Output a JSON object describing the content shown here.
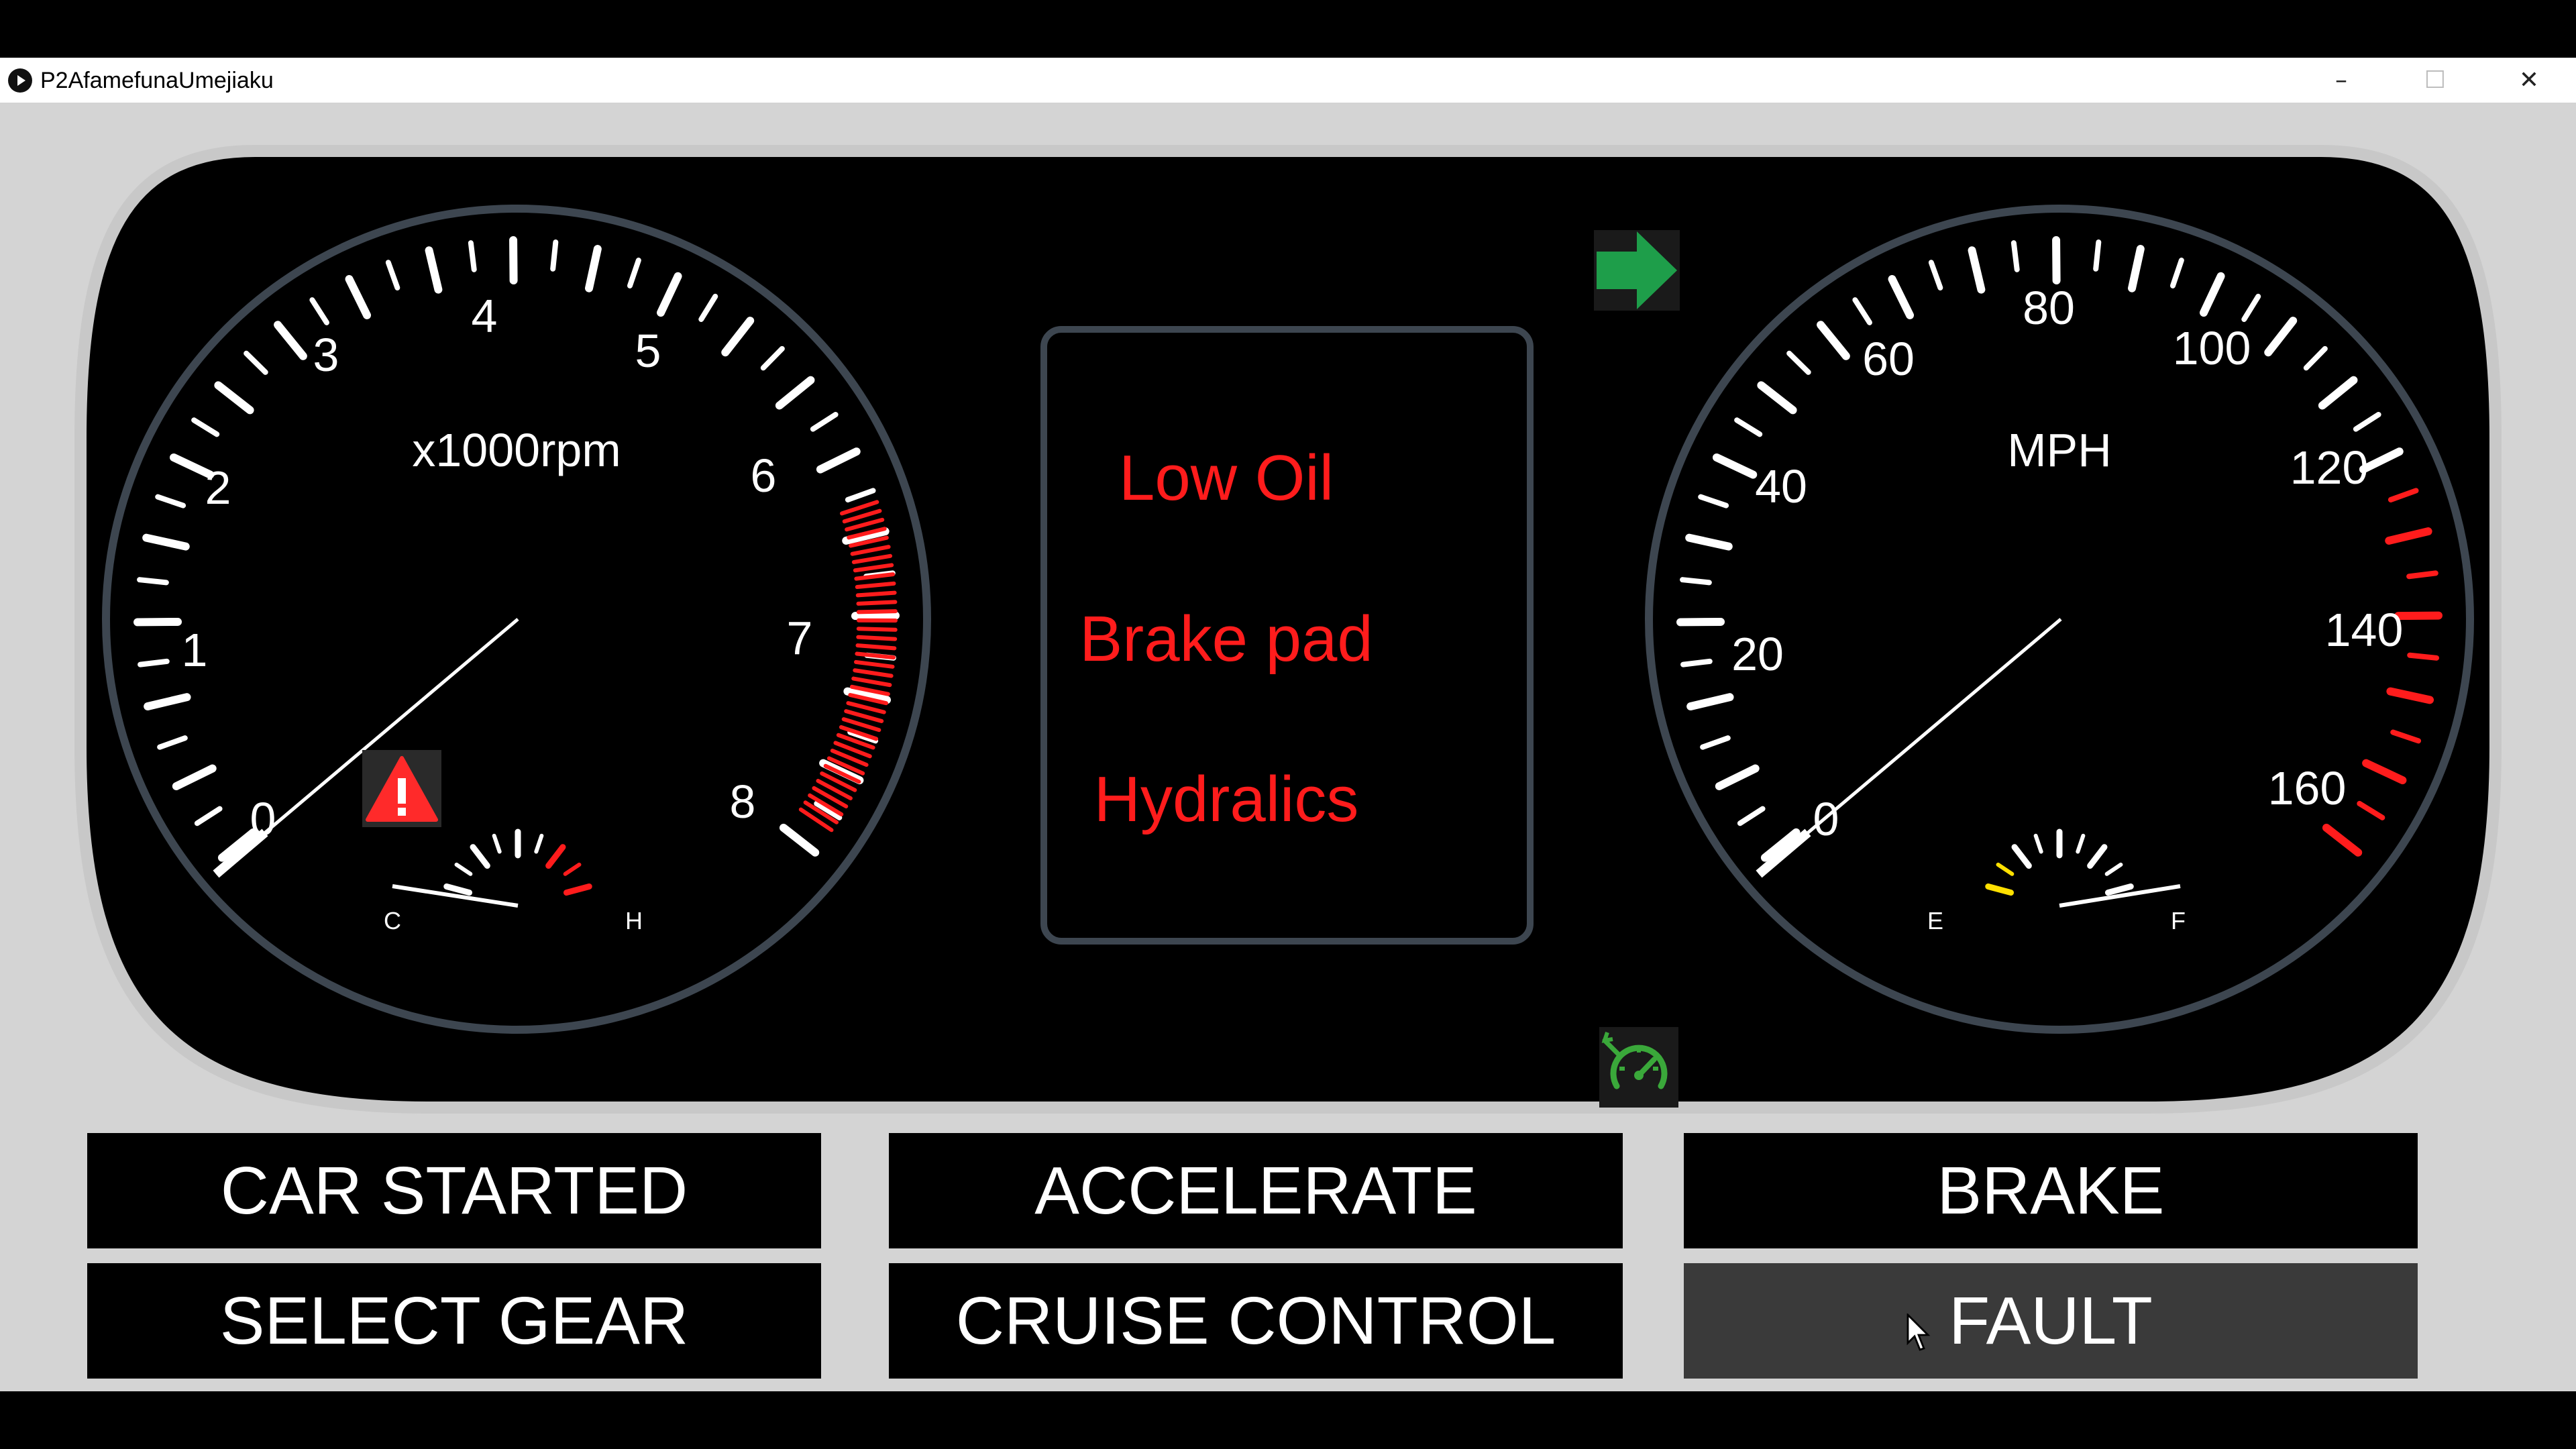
{
  "window": {
    "title": "P2AfamefunaUmejiaku",
    "controls": {
      "minimize": "–",
      "maximize": "☐",
      "close": "✕"
    }
  },
  "tachometer": {
    "unit_label": "x1000rpm",
    "numbers": [
      "0",
      "1",
      "2",
      "3",
      "4",
      "5",
      "6",
      "7",
      "8"
    ],
    "temp_gauge": {
      "cold_label": "C",
      "hot_label": "H",
      "level": 0.05
    }
  },
  "speedometer": {
    "unit_label": "MPH",
    "numbers": [
      "0",
      "20",
      "40",
      "60",
      "80",
      "100",
      "120",
      "140",
      "160"
    ],
    "fuel_gauge": {
      "empty_label": "E",
      "full_label": "F",
      "level": 0.95
    }
  },
  "warnings": {
    "items": [
      "Low Oil",
      "Brake pad",
      "Hydralics"
    ]
  },
  "indicators": {
    "turn_signal": "right-arrow-icon",
    "cruise": "cruise-control-icon",
    "warning": "warning-triangle-icon"
  },
  "buttons": {
    "car_started": "CAR STARTED",
    "accelerate": "ACCELERATE",
    "brake": "BRAKE",
    "select_gear": "SELECT GEAR",
    "cruise_control": "CRUISE CONTROL",
    "fault": "FAULT"
  },
  "colors": {
    "warning_text": "#ff1c1c",
    "turn_signal": "#1e9e4a",
    "cruise": "#3aa83a",
    "fuel_low": "#ffe000"
  }
}
